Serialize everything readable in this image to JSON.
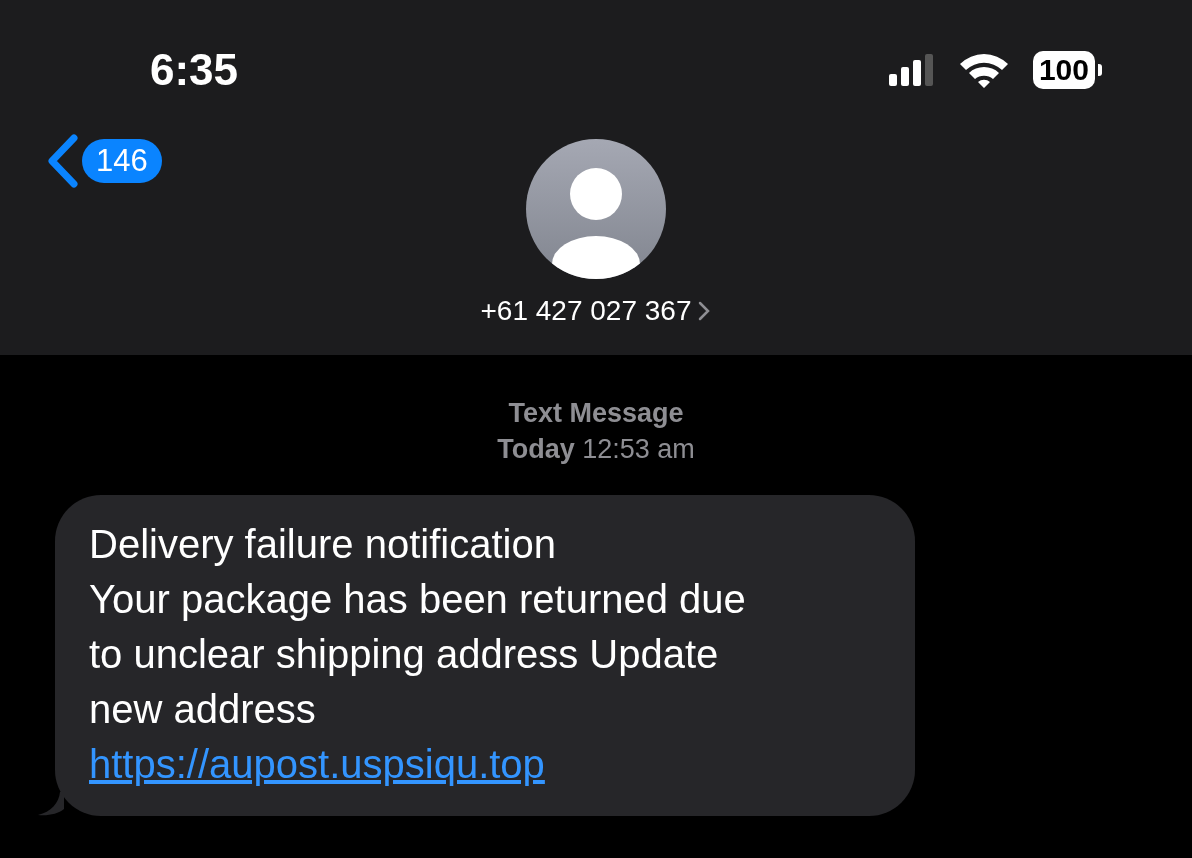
{
  "status_bar": {
    "time": "6:35",
    "battery": "100"
  },
  "header": {
    "back_count": "146",
    "contact": "+61 427 027 367"
  },
  "conversation": {
    "service": "Text Message",
    "timestamp": "**Today** 12:53 am",
    "messages": [
      {
        "kind": "incoming",
        "title": "Delivery failure notification",
        "text": "Your package has been returned due to unclear shipping address Update new address",
        "link": "https://aupost.uspsiqu.top"
      }
    ]
  }
}
